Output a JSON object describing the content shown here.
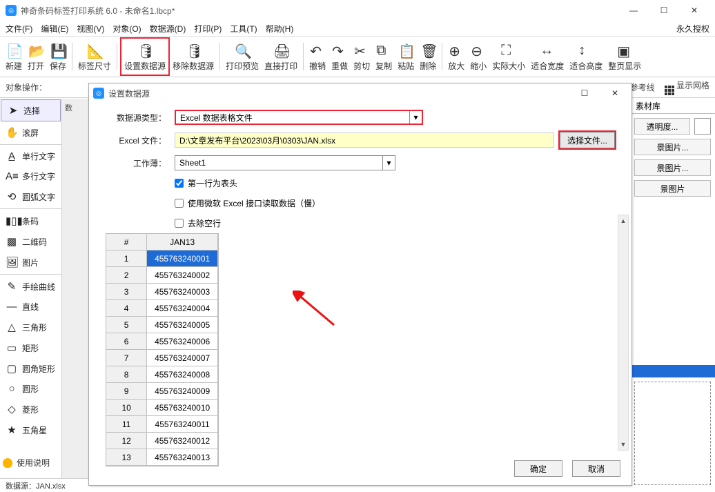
{
  "title": "神奇条码标签打印系统 6.0 - 未命名1.lbcp*",
  "menus": [
    "文件(F)",
    "编辑(E)",
    "视图(V)",
    "对象(O)",
    "数据源(D)",
    "打印(P)",
    "工具(T)",
    "帮助(H)"
  ],
  "perm": "永久授权",
  "toolbar": [
    "新建",
    "打开",
    "保存",
    "标签尺寸",
    "设置数据源",
    "移除数据源",
    "打印预览",
    "直接打印",
    "撤销",
    "重做",
    "剪切",
    "复制",
    "粘贴",
    "删除",
    "放大",
    "缩小",
    "实际大小",
    "适合宽度",
    "适合高度",
    "整页显示"
  ],
  "toolbar_hl_index": 4,
  "objrow_label": "对象操作：",
  "objrow_right": [
    "参考线",
    "显示网格"
  ],
  "left_tools": [
    {
      "ic": "➤",
      "t": "选择",
      "sel": true
    },
    {
      "ic": "✋",
      "t": "滚屏"
    },
    {
      "sep": true
    },
    {
      "ic": "A̲",
      "t": "单行文字"
    },
    {
      "ic": "A≡",
      "t": "多行文字"
    },
    {
      "ic": "⟲",
      "t": "圆弧文字"
    },
    {
      "sep": true
    },
    {
      "ic": "▮▯▮",
      "t": "条码"
    },
    {
      "ic": "▩",
      "t": "二维码"
    },
    {
      "ic": "🖼",
      "t": "图片"
    },
    {
      "sep": true
    },
    {
      "ic": "✎",
      "t": "手绘曲线"
    },
    {
      "ic": "—",
      "t": "直线"
    },
    {
      "ic": "△",
      "t": "三角形"
    },
    {
      "ic": "▭",
      "t": "矩形"
    },
    {
      "ic": "▢",
      "t": "圆角矩形"
    },
    {
      "ic": "○",
      "t": "圆形"
    },
    {
      "ic": "◇",
      "t": "菱形"
    },
    {
      "ic": "★",
      "t": "五角星"
    }
  ],
  "help_label": "使用说明",
  "statusbar": "数据源：JAN.xlsx",
  "tabhdr": "数",
  "right": {
    "tab": "素材库",
    "btns": [
      "透明度...",
      "景图片...",
      "景图片...",
      "景图片"
    ]
  },
  "dialog": {
    "title": "设置数据源",
    "labels": {
      "type": "数据源类型：",
      "file": "Excel 文件：",
      "sheet": "工作薄："
    },
    "type_value": "Excel 数据表格文件",
    "file_value": "D:\\文章发布平台\\2023\\03月\\0303\\JAN.xlsx",
    "sheet_value": "Sheet1",
    "browse": "选择文件...",
    "checks": [
      "第一行为表头",
      "使用微软 Excel 接口读取数据（慢）",
      "去除空行"
    ],
    "check_values": [
      true,
      false,
      false
    ],
    "table": {
      "headers": [
        "#",
        "JAN13"
      ],
      "rows": [
        [
          "1",
          "455763240001"
        ],
        [
          "2",
          "455763240002"
        ],
        [
          "3",
          "455763240003"
        ],
        [
          "4",
          "455763240004"
        ],
        [
          "5",
          "455763240005"
        ],
        [
          "6",
          "455763240006"
        ],
        [
          "7",
          "455763240007"
        ],
        [
          "8",
          "455763240008"
        ],
        [
          "9",
          "455763240009"
        ],
        [
          "10",
          "455763240010"
        ],
        [
          "11",
          "455763240011"
        ],
        [
          "12",
          "455763240012"
        ],
        [
          "13",
          "455763240013"
        ]
      ],
      "sel": 0
    },
    "ok": "确定",
    "cancel": "取消"
  }
}
